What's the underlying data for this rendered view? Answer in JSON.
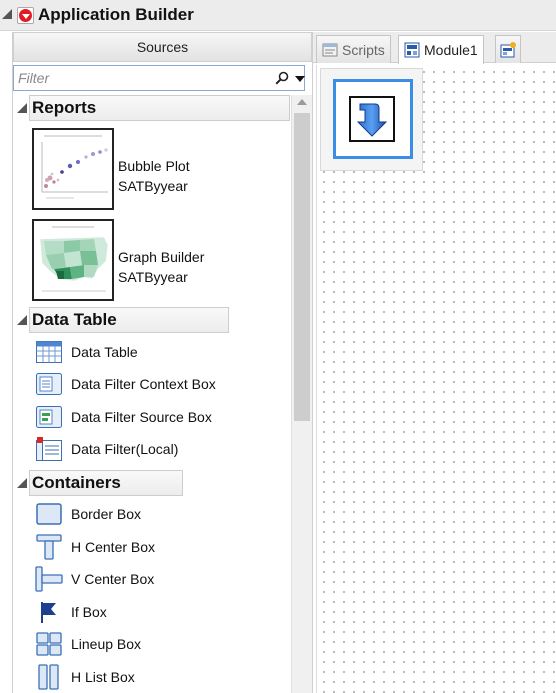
{
  "app": {
    "title": "Application Builder"
  },
  "sources": {
    "header": "Sources",
    "filter_placeholder": "Filter"
  },
  "sections": {
    "reports": {
      "title": "Reports",
      "items": [
        {
          "name": "Bubble Plot",
          "source": "SATByyear"
        },
        {
          "name": "Graph Builder",
          "source": "SATByyear"
        }
      ]
    },
    "data_table": {
      "title": "Data Table",
      "items": [
        {
          "label": "Data Table",
          "icon": "data-table-icon"
        },
        {
          "label": "Data Filter Context Box",
          "icon": "data-filter-context-box-icon"
        },
        {
          "label": "Data Filter Source Box",
          "icon": "data-filter-source-box-icon"
        },
        {
          "label": "Data Filter(Local)",
          "icon": "data-filter-local-icon"
        }
      ]
    },
    "containers": {
      "title": "Containers",
      "items": [
        {
          "label": "Border Box",
          "icon": "border-box-icon"
        },
        {
          "label": "H Center Box",
          "icon": "h-center-box-icon"
        },
        {
          "label": "V Center Box",
          "icon": "v-center-box-icon"
        },
        {
          "label": "If Box",
          "icon": "if-box-icon"
        },
        {
          "label": "Lineup Box",
          "icon": "lineup-box-icon"
        },
        {
          "label": "H List Box",
          "icon": "h-list-box-icon"
        }
      ]
    }
  },
  "tabs": [
    {
      "label": "Scripts",
      "icon": "scripts-icon",
      "active": false
    },
    {
      "label": "Module1",
      "icon": "module-icon",
      "active": true
    },
    {
      "label": "",
      "icon": "new-module-icon",
      "active": false
    }
  ],
  "colors": {
    "accent_blue": "#3a8ee6",
    "menu_red": "#e31c23",
    "icon_blue": "#1f5fbf"
  }
}
